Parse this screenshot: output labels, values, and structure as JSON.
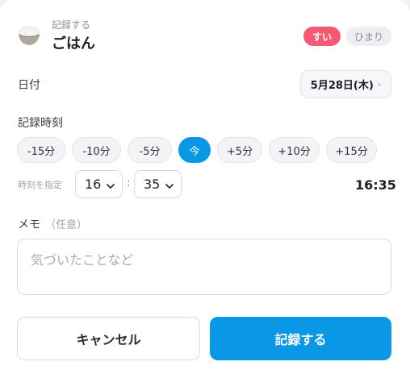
{
  "header": {
    "icon": "rice-bowl-icon",
    "subtitle": "記録する",
    "title": "ごはん",
    "status_options": [
      {
        "label": "すい",
        "active": true
      },
      {
        "label": "ひまり",
        "active": false
      }
    ]
  },
  "date": {
    "label": "日付",
    "value": "5月28日(木)",
    "chevron": "›"
  },
  "time": {
    "label": "記録時刻",
    "quick_buttons": [
      "-15分",
      "-10分",
      "-5分",
      "今",
      "+5分",
      "+10分",
      "+15分"
    ],
    "specify_label": "時刻を指定",
    "hour": "16",
    "separator": ":",
    "minute": "35",
    "display": "16:35"
  },
  "memo": {
    "label": "メモ",
    "optional_label": "（任意）",
    "placeholder": "気づいたことなど",
    "value": ""
  },
  "actions": {
    "cancel_label": "キャンセル",
    "submit_label": "記録する"
  },
  "colors": {
    "accent": "#0a98e6",
    "status_active": "#f45a74"
  }
}
